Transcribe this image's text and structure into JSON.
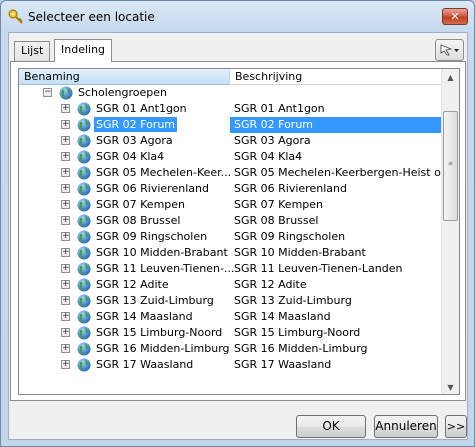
{
  "window": {
    "title": "Selecteer een locatie"
  },
  "tabs": [
    {
      "label": "Lijst",
      "active": false
    },
    {
      "label": "Indeling",
      "active": true
    }
  ],
  "columns": {
    "name": "Benaming",
    "description": "Beschrijving"
  },
  "root": {
    "label": "Scholengroepen",
    "expanded": true
  },
  "selected_index": 1,
  "items": [
    {
      "name": "SGR 01 Ant1gon",
      "description": "SGR 01 Ant1gon"
    },
    {
      "name": "SGR 02 Forum",
      "description": "SGR 02 Forum"
    },
    {
      "name": "SGR 03 Agora",
      "description": "SGR 03 Agora"
    },
    {
      "name": "SGR 04 Kla4",
      "description": "SGR 04 Kla4"
    },
    {
      "name": "SGR 05 Mechelen-Keer...",
      "description": "SGR 05 Mechelen-Keerbergen-Heist o..."
    },
    {
      "name": "SGR 06 Rivierenland",
      "description": "SGR 06 Rivierenland"
    },
    {
      "name": "SGR 07 Kempen",
      "description": "SGR 07 Kempen"
    },
    {
      "name": "SGR 08 Brussel",
      "description": "SGR 08 Brussel"
    },
    {
      "name": "SGR 09 Ringscholen",
      "description": "SGR 09 Ringscholen"
    },
    {
      "name": "SGR 10 Midden-Brabant",
      "description": "SGR 10 Midden-Brabant"
    },
    {
      "name": "SGR 11 Leuven-Tienen-...",
      "description": "SGR 11 Leuven-Tienen-Landen"
    },
    {
      "name": "SGR 12 Adite",
      "description": "SGR 12 Adite"
    },
    {
      "name": "SGR 13 Zuid-Limburg",
      "description": "SGR 13 Zuid-Limburg"
    },
    {
      "name": "SGR 14 Maasland",
      "description": "SGR 14 Maasland"
    },
    {
      "name": "SGR 15 Limburg-Noord",
      "description": "SGR 15 Limburg-Noord"
    },
    {
      "name": "SGR 16 Midden-Limburg",
      "description": "SGR 16 Midden-Limburg"
    },
    {
      "name": "SGR 17 Waasland",
      "description": "SGR 17 Waasland"
    }
  ],
  "buttons": {
    "ok": "OK",
    "cancel": "Annuleren",
    "more": ">>"
  },
  "icons": {
    "app": "key-icon",
    "tool": "pointer-dropdown-icon",
    "node": "globe-icon"
  },
  "colors": {
    "selection": "#3399ff",
    "title_bg": "#c6d9ee"
  }
}
